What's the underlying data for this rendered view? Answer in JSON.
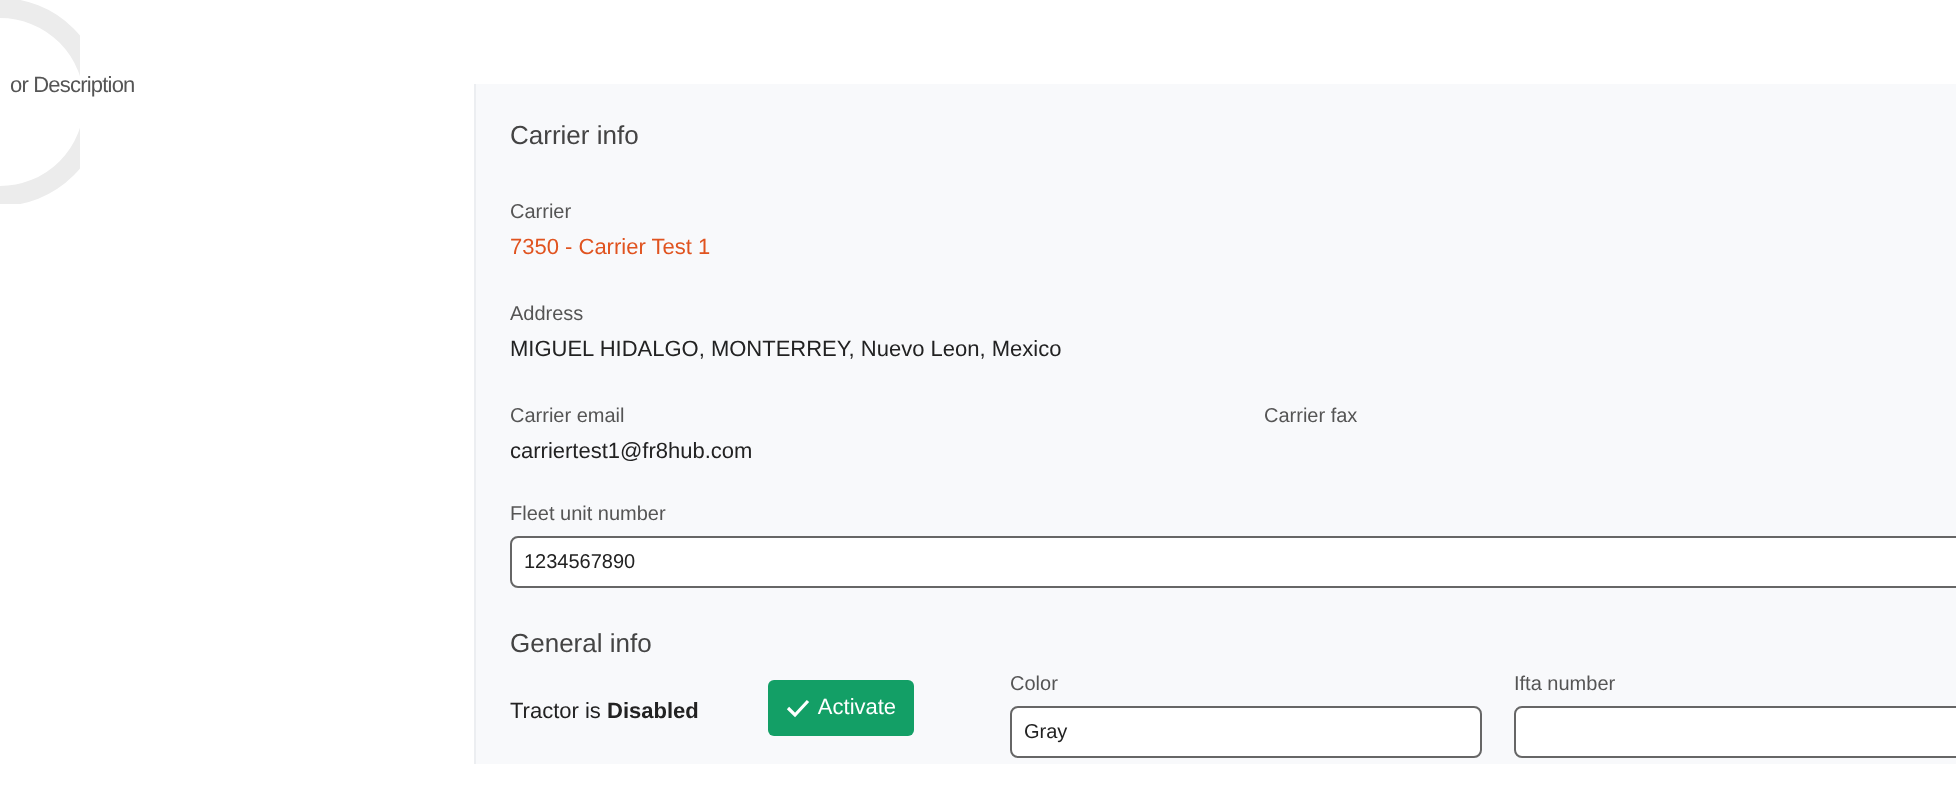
{
  "left_text": "or Description",
  "carrier_info": {
    "title": "Carrier info",
    "carrier": {
      "label": "Carrier",
      "value": "7350 - Carrier Test 1"
    },
    "address": {
      "label": "Address",
      "value": "MIGUEL HIDALGO, MONTERREY, Nuevo Leon, Mexico"
    },
    "carrier_email": {
      "label": "Carrier email",
      "value": "carriertest1@fr8hub.com"
    },
    "carrier_fax": {
      "label": "Carrier fax"
    },
    "fleet_unit_number": {
      "label": "Fleet unit number",
      "value": "1234567890"
    }
  },
  "general_info": {
    "title": "General info",
    "status": "Tractor is **Disabled**",
    "button": "Activate",
    "color": {
      "label": "Color",
      "value": "Gray"
    },
    "ifta_number": {
      "label": "Ifta number"
    }
  }
}
